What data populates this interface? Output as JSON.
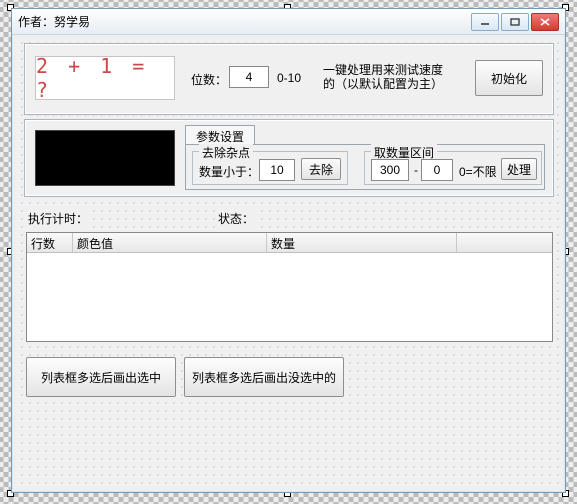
{
  "window": {
    "title": "作者：努学易"
  },
  "top": {
    "captcha_text": "2 + 1 = ?",
    "digit_label": "位数：",
    "digit_value": "4",
    "digit_range": "0-10",
    "hint_text": "一键处理用来测试速度的（以默认配置为主）",
    "init_button": "初始化"
  },
  "mid": {
    "tab_label": "参数设置",
    "noise_group": "去除杂点",
    "noise_label": "数量小于：",
    "noise_value": "10",
    "noise_button": "去除",
    "range_group": "取数量区间",
    "range_min": "300",
    "range_sep": "-",
    "range_max": "0",
    "range_suffix": "0=不限",
    "range_button": "处理"
  },
  "status": {
    "exec_label": "执行计时：",
    "state_label": "状态："
  },
  "list": {
    "col1": "行数",
    "col2": "颜色值",
    "col3": "数量"
  },
  "bottom": {
    "btn1": "列表框多选后画出选中",
    "btn2": "列表框多选后画出没选中的"
  }
}
